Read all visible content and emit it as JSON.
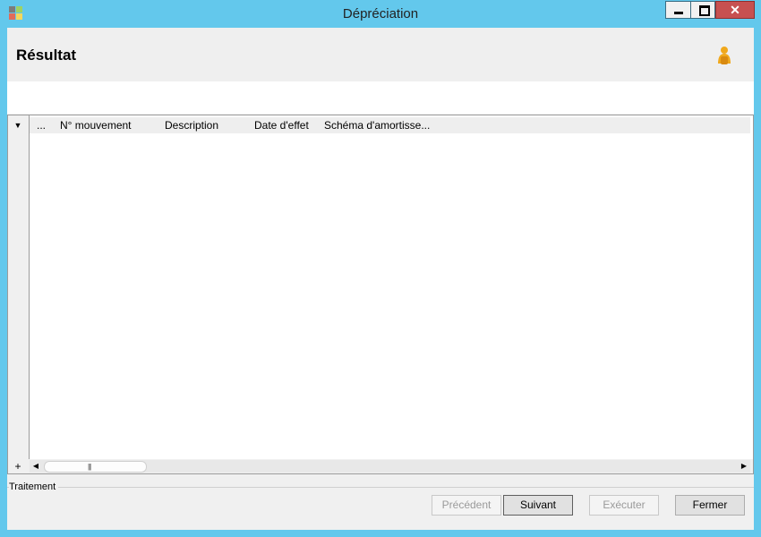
{
  "window": {
    "title": "Dépréciation",
    "close_glyph": "✕",
    "icon_colors": [
      "#7c7c7c",
      "#9ed264",
      "#e26b5a",
      "#f4d75c"
    ]
  },
  "header": {
    "title": "Résultat",
    "icon": "user-icon"
  },
  "grid": {
    "menu_glyph": "▼",
    "columns": [
      "...",
      "N° mouvement",
      "Description",
      "Date d'effet",
      "Schéma d'amortisse..."
    ],
    "rows": [],
    "add_glyph": "+",
    "scroll_left_glyph": "◀",
    "scroll_right_glyph": "▶",
    "scroll_grip_glyph": "|||"
  },
  "footer": {
    "group_label": "Traitement",
    "buttons": {
      "previous": "Précédent",
      "next": "Suivant",
      "execute": "Exécuter",
      "close": "Fermer"
    }
  },
  "colors": {
    "title_bar": "#63c8ec",
    "close_button": "#c75050",
    "user_icon": "#f0a81c"
  }
}
